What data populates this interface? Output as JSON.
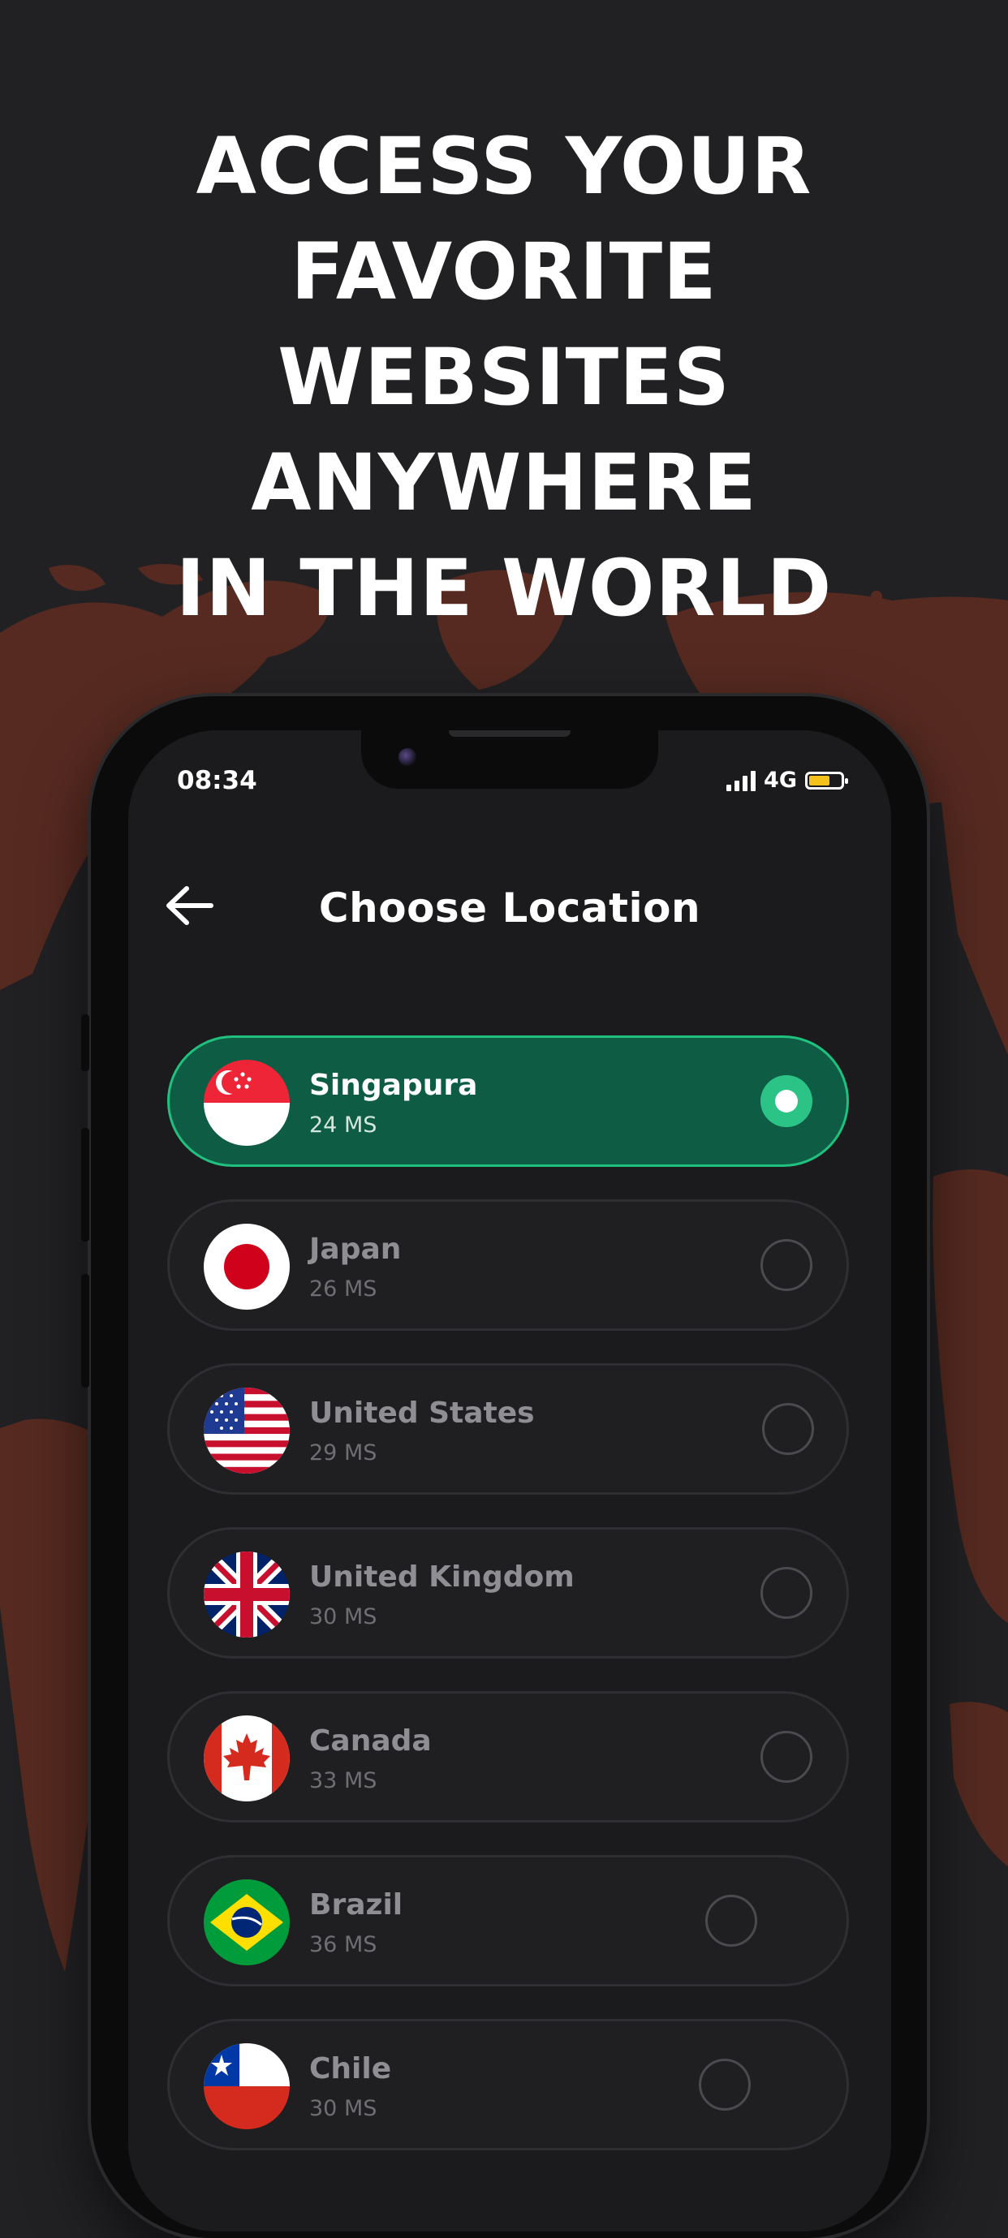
{
  "headline": {
    "lines": [
      "ACCESS YOUR",
      "FAVORITE",
      "WEBSITES",
      "ANYWHERE",
      "IN THE WORLD"
    ]
  },
  "status_bar": {
    "time": "08:34",
    "network": "4G",
    "signal_icon": "cellular-signal-icon",
    "battery_icon": "battery-icon",
    "battery_level": 0.65
  },
  "screen": {
    "title": "Choose Location",
    "back_icon": "arrow-left-icon"
  },
  "locations": [
    {
      "name": "Singapura",
      "ping": "24 MS",
      "selected": true,
      "flag_icon": "singapore-flag-icon"
    },
    {
      "name": "Japan",
      "ping": "26 MS",
      "selected": false,
      "flag_icon": "japan-flag-icon"
    },
    {
      "name": "United States",
      "ping": "29 MS",
      "selected": false,
      "flag_icon": "us-flag-icon"
    },
    {
      "name": "United Kingdom",
      "ping": "30 MS",
      "selected": false,
      "flag_icon": "uk-flag-icon"
    },
    {
      "name": "Canada",
      "ping": "33 MS",
      "selected": false,
      "flag_icon": "canada-flag-icon"
    },
    {
      "name": "Brazil",
      "ping": "36 MS",
      "selected": false,
      "flag_icon": "brazil-flag-icon"
    },
    {
      "name": "Chile",
      "ping": "30 MS",
      "selected": false,
      "flag_icon": "chile-flag-icon"
    }
  ],
  "colors": {
    "background": "#212124",
    "map": "#5c2c22",
    "selected_bg": "#0e5c44",
    "accent": "#2bc486"
  }
}
